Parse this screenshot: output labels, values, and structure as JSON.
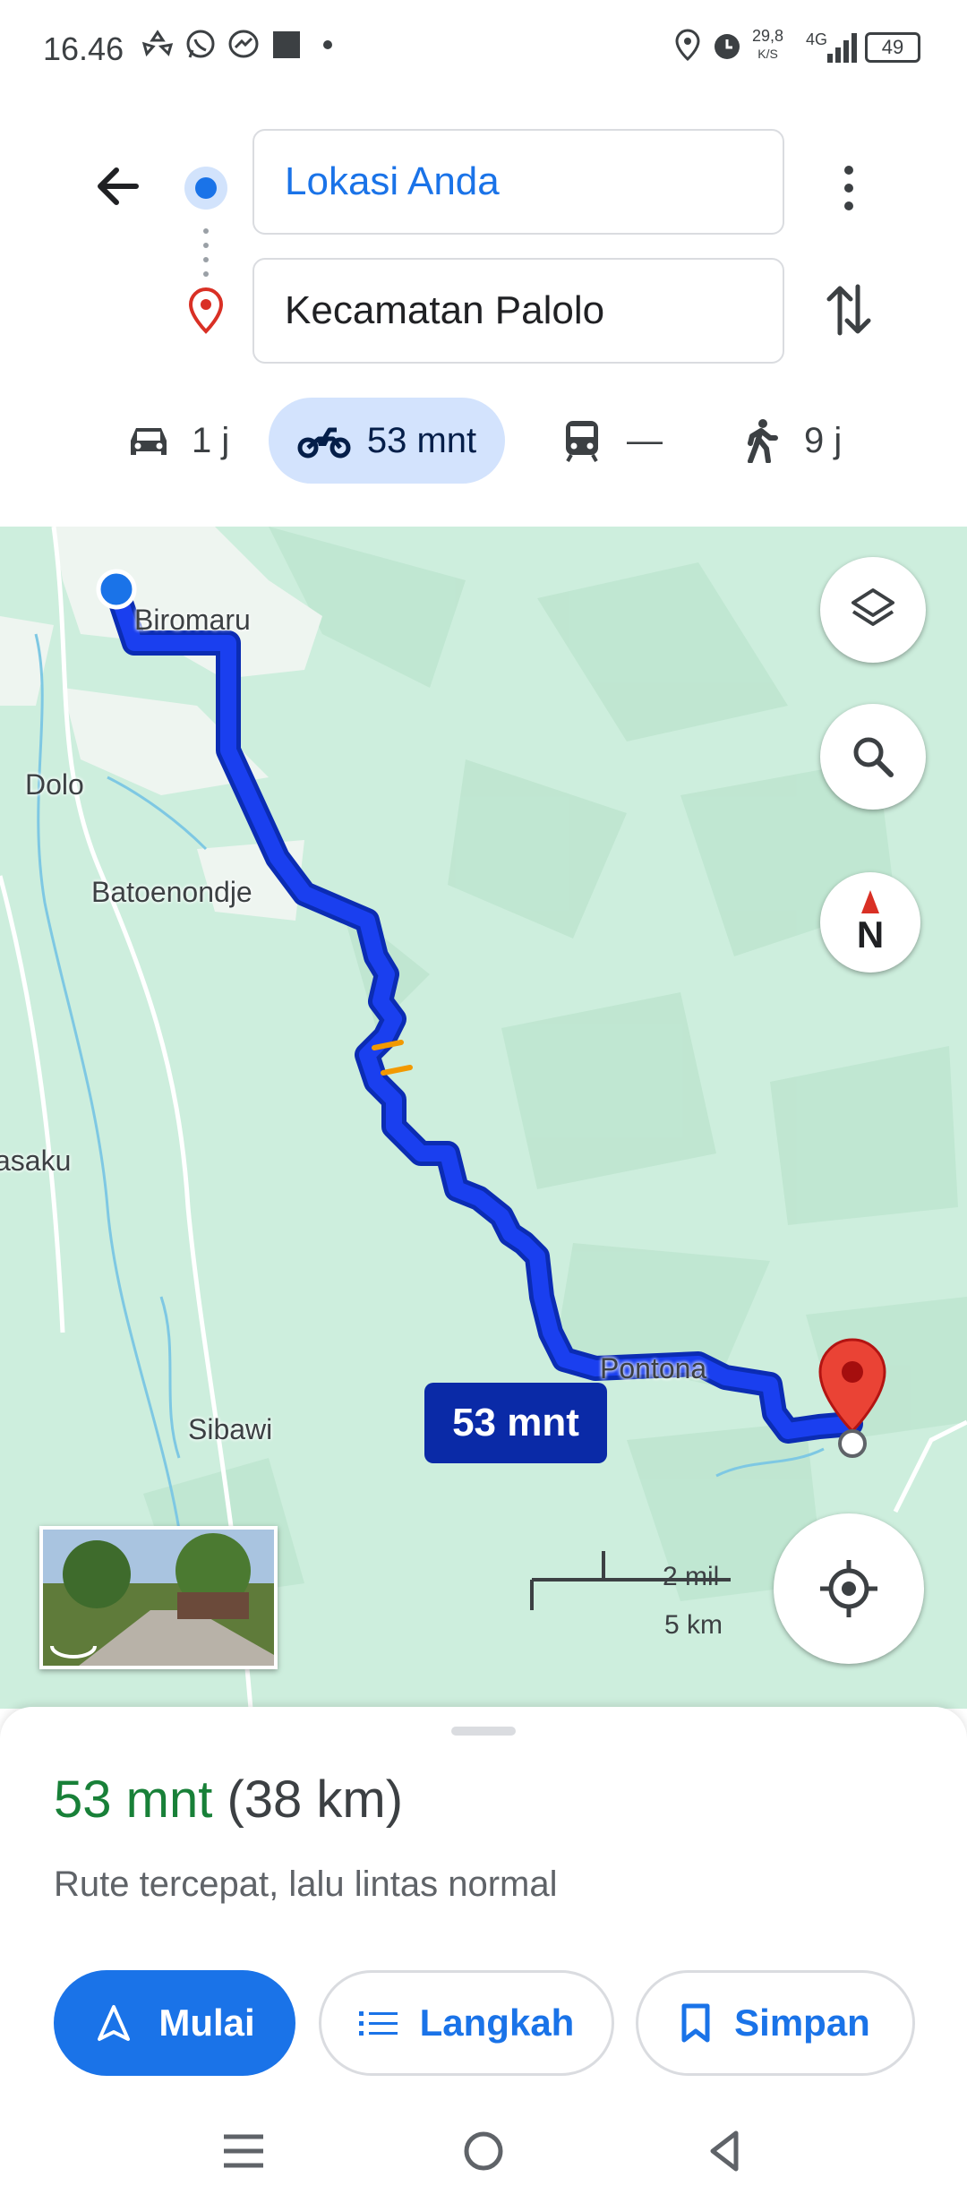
{
  "status_bar": {
    "time": "16.46",
    "speed_value": "29,8",
    "speed_unit": "K/S",
    "network": "4G",
    "battery": "49",
    "icons": [
      "sync-icon",
      "whatsapp-icon",
      "messenger-icon",
      "square-icon",
      "dot-icon",
      "location-icon",
      "alarm-icon",
      "signal-icon",
      "battery-icon"
    ]
  },
  "directions": {
    "origin": "Lokasi Anda",
    "destination": "Kecamatan Palolo"
  },
  "modes": [
    {
      "icon": "car-icon",
      "label": "1 j"
    },
    {
      "icon": "motorcycle-icon",
      "label": "53 mnt",
      "selected": true
    },
    {
      "icon": "transit-icon",
      "label": "—"
    },
    {
      "icon": "walk-icon",
      "label": "9 j"
    }
  ],
  "map": {
    "labels": {
      "biromaru": "Biromaru",
      "dolo": "Dolo",
      "batoenondje": "Batoenondje",
      "asaku": "asaku",
      "sibawi": "Sibawi",
      "pontona": "Pontona"
    },
    "duration_badge": "53 mnt",
    "scale_miles": "2 mil",
    "scale_km": "5 km",
    "compass_letter": "N",
    "colors": {
      "route": "#1a3fef",
      "map_bg": "#cdeedd",
      "pin": "#ea4335"
    }
  },
  "sheet": {
    "time": "53 mnt",
    "distance": "(38 km)",
    "description": "Rute tercepat, lalu lintas normal",
    "start_label": "Mulai",
    "steps_label": "Langkah",
    "save_label": "Simpan"
  }
}
